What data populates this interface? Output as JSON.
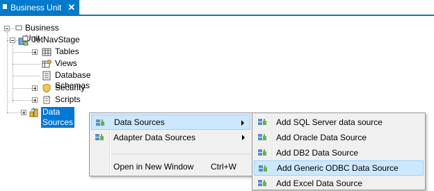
{
  "tab": {
    "title": "Business Unit",
    "close": "✕"
  },
  "tree": {
    "root": "Business Unit",
    "stage": "JetNavStage",
    "children": [
      "Tables",
      "Views",
      "Database Schemas",
      "Security",
      "Scripts"
    ],
    "data_sources": "Data Sources"
  },
  "context_menu": {
    "items": [
      {
        "label": "Data Sources",
        "shortcut": "",
        "submenu": true
      },
      {
        "label": "Adapter Data Sources",
        "shortcut": "",
        "submenu": true
      },
      {
        "label": "Open in New Window",
        "shortcut": "Ctrl+W",
        "submenu": false
      }
    ]
  },
  "submenu": {
    "items": [
      "Add SQL Server data source",
      "Add Oracle Data Source",
      "Add DB2 Data Source",
      "Add Generic ODBC Data Source",
      "Add Excel Data Source"
    ]
  },
  "colors": {
    "accent": "#007acc",
    "selection": "#0078d7",
    "menu_hover": "#cce8ff"
  }
}
